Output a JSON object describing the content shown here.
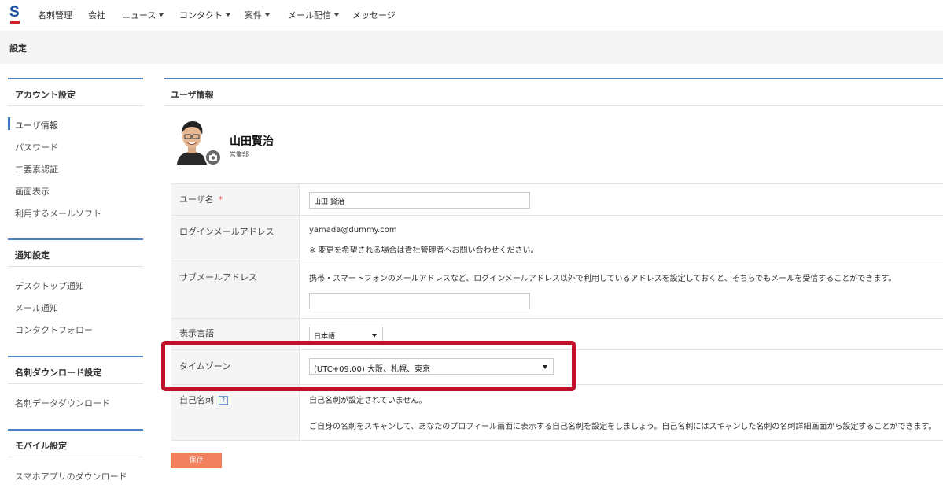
{
  "nav": {
    "logo": "S",
    "items": [
      {
        "label": "名刺管理",
        "dropdown": false
      },
      {
        "label": "会社",
        "dropdown": false
      },
      {
        "label": "ニュース",
        "dropdown": true
      },
      {
        "label": "コンタクト",
        "dropdown": true
      },
      {
        "label": "案件",
        "dropdown": true
      },
      {
        "label": "メール配信",
        "dropdown": true
      },
      {
        "label": "メッセージ",
        "dropdown": false
      }
    ]
  },
  "page": {
    "title": "設定"
  },
  "sidebar": {
    "sections": [
      {
        "title": "アカウント設定",
        "items": [
          "ユーザ情報",
          "パスワード",
          "二要素認証",
          "画面表示",
          "利用するメールソフト"
        ]
      },
      {
        "title": "通知設定",
        "items": [
          "デスクトップ通知",
          "メール通知",
          "コンタクトフォロー"
        ]
      },
      {
        "title": "名刺ダウンロード設定",
        "items": [
          "名刺データダウンロード"
        ]
      },
      {
        "title": "モバイル設定",
        "items": [
          "スマホアプリのダウンロード"
        ]
      }
    ],
    "active_item": "ユーザ情報"
  },
  "main": {
    "panel_title": "ユーザ情報",
    "profile": {
      "name": "山田賢治",
      "department": "営業部"
    },
    "form": {
      "username_label": "ユーザ名",
      "required_mark": "*",
      "username_value": "山田 賢治",
      "login_email_label": "ログインメールアドレス",
      "login_email_value": "yamada@dummy.com",
      "login_email_note": "※ 変更を希望される場合は貴社管理者へお問い合わせください。",
      "sub_email_label": "サブメールアドレス",
      "sub_email_description": "携帯・スマートフォンのメールアドレスなど、ログインメールアドレス以外で利用しているアドレスを設定しておくと、そちらでもメールを受信することができます。",
      "sub_email_value": "",
      "language_label": "表示言語",
      "language_value": "日本語",
      "timezone_label": "タイムゾーン",
      "timezone_value": "(UTC+09:00) 大阪、札幌、東京",
      "own_card_label": "自己名刺",
      "own_card_help": "?",
      "own_card_status": "自己名刺が設定されていません。",
      "own_card_description": "ご自身の名刺をスキャンして、あなたのプロフィール画面に表示する自己名刺を設定をしましょう。自己名刺にはスキャンした名刺の名刺詳細画面から設定することができます。"
    },
    "save_label": "保存"
  },
  "colors": {
    "accent": "#4c80c0",
    "save_button": "#f0805e",
    "highlight": "#c0102a"
  }
}
